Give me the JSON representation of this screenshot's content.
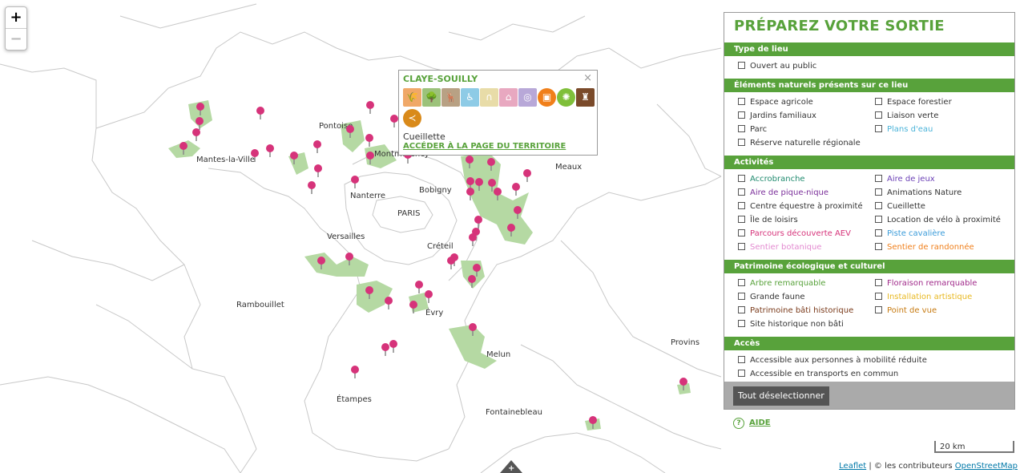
{
  "map": {
    "zoom_in": "+",
    "zoom_out": "−",
    "places": [
      {
        "name": "Mantes-la-Ville"
      },
      {
        "name": "Pontoise"
      },
      {
        "name": "Montmorency"
      },
      {
        "name": "Meaux"
      },
      {
        "name": "Nanterre"
      },
      {
        "name": "Bobigny"
      },
      {
        "name": "PARIS"
      },
      {
        "name": "Versailles"
      },
      {
        "name": "Créteil"
      },
      {
        "name": "Rambouillet"
      },
      {
        "name": "Évry"
      },
      {
        "name": "Melun"
      },
      {
        "name": "Provins"
      },
      {
        "name": "Étampes"
      },
      {
        "name": "Fontainebleau"
      }
    ],
    "pin_color": "#d6337a",
    "green_area_color": "#b5d9a3",
    "scale_label": "20 km",
    "attribution": {
      "leaflet": "Leaflet",
      "separator": " | © les contributeurs ",
      "osm": "OpenStreetMap"
    },
    "handle_label": "+"
  },
  "popup": {
    "title": "CLAYE-SOUILLY",
    "close": "×",
    "icons": [
      {
        "name": "agriculture-icon",
        "color": "#f0a868",
        "shape": "square",
        "glyph": "🌾"
      },
      {
        "name": "tree-icon",
        "color": "#9cc27a",
        "shape": "square",
        "glyph": "🌳"
      },
      {
        "name": "deer-icon",
        "color": "#b8a184",
        "shape": "square",
        "glyph": "🦌"
      },
      {
        "name": "accessibility-icon",
        "color": "#8ecbe6",
        "shape": "square",
        "glyph": "♿"
      },
      {
        "name": "horseshoe-icon",
        "color": "#e8dca8",
        "shape": "square",
        "glyph": "∩"
      },
      {
        "name": "basket-icon",
        "color": "#e8a8c0",
        "shape": "square",
        "glyph": "⌂"
      },
      {
        "name": "compass-icon",
        "color": "#b8a8d8",
        "shape": "square",
        "glyph": "◎"
      },
      {
        "name": "transport-icon",
        "color": "#f07f1a",
        "shape": "round",
        "glyph": "▣"
      },
      {
        "name": "viewpoint-icon",
        "color": "#7fbf3a",
        "shape": "round",
        "glyph": "✺"
      },
      {
        "name": "castle-icon",
        "color": "#7a4a2a",
        "shape": "square",
        "glyph": "♜"
      },
      {
        "name": "trail-icon",
        "color": "#d98a1a",
        "shape": "round",
        "glyph": "≺"
      }
    ],
    "type": "Cueillette",
    "link": "ACCÉDER À LA PAGE DU TERRITOIRE"
  },
  "panel": {
    "title": "PRÉPAREZ VOTRE SORTIE",
    "sections": [
      {
        "label": "Type de lieu"
      },
      {
        "label": "Éléments naturels présents sur ce lieu"
      },
      {
        "label": "Activités"
      },
      {
        "label": "Patrimoine écologique et culturel"
      },
      {
        "label": "Accès"
      }
    ],
    "options": [
      {
        "label": "Ouvert au public",
        "color": "#333333"
      },
      {
        "label": "Espace agricole",
        "color": "#333333"
      },
      {
        "label": "Espace forestier",
        "color": "#333333"
      },
      {
        "label": "Jardins familiaux",
        "color": "#333333"
      },
      {
        "label": "Liaison verte",
        "color": "#333333"
      },
      {
        "label": "Parc",
        "color": "#333333"
      },
      {
        "label": "Plans d'eau",
        "color": "#4ab3d9"
      },
      {
        "label": "Réserve naturelle régionale",
        "color": "#333333"
      },
      {
        "label": "Accrobranche",
        "color": "#1f8a6e"
      },
      {
        "label": "Aire de jeux",
        "color": "#6a3fb5"
      },
      {
        "label": "Aire de pique-nique",
        "color": "#7b2f9a"
      },
      {
        "label": "Animations Nature",
        "color": "#333333"
      },
      {
        "label": "Centre équestre à proximité",
        "color": "#333333"
      },
      {
        "label": "Cueillette",
        "color": "#333333"
      },
      {
        "label": "Île de loisirs",
        "color": "#333333"
      },
      {
        "label": "Location de vélo à proximité",
        "color": "#333333"
      },
      {
        "label": "Parcours découverte AEV",
        "color": "#d6337a"
      },
      {
        "label": "Piste cavalière",
        "color": "#3a9bd9"
      },
      {
        "label": "Sentier botanique",
        "color": "#e38ad0"
      },
      {
        "label": "Sentier de randonnée",
        "color": "#f07f1a"
      },
      {
        "label": "Arbre remarquable",
        "color": "#58a23b"
      },
      {
        "label": "Floraison remarquable",
        "color": "#a02a8a"
      },
      {
        "label": "Grande faune",
        "color": "#333333"
      },
      {
        "label": "Installation artistique",
        "color": "#e8b820"
      },
      {
        "label": "Patrimoine bâti historique",
        "color": "#7a3a1a"
      },
      {
        "label": "Point de vue",
        "color": "#c77a10"
      },
      {
        "label": "Site historique non bâti",
        "color": "#333333"
      },
      {
        "label": "Accessible aux personnes à mobilité réduite",
        "color": "#333333"
      },
      {
        "label": "Accessible en transports en commun",
        "color": "#333333"
      }
    ],
    "deselect_button": "Tout déselectionner",
    "help_glyph": "?",
    "help_label": "AIDE"
  }
}
